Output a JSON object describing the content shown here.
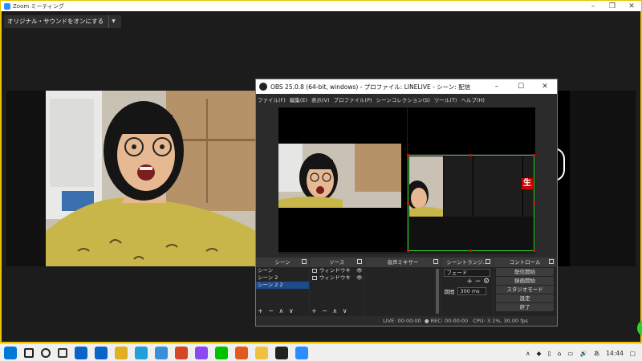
{
  "zoom": {
    "title": "Zoom ミーティング",
    "audio_button": "オリジナル・サウンドをオンにする",
    "window_controls": [
      "–",
      "❐",
      "✕"
    ]
  },
  "obs": {
    "title": "OBS 25.0.8 (64-bit, windows) - プロファイル: LINELIVE - シーン: 配信",
    "window_controls": [
      "–",
      "☐",
      "✕"
    ],
    "menu": [
      "ファイル(F)",
      "編集(E)",
      "表示(V)",
      "プロファイル(P)",
      "シーンコレクション(S)",
      "ツール(T)",
      "ヘルプ(H)"
    ],
    "docks": {
      "scenes_title": "シーン",
      "scenes": [
        "シーン",
        "シーン 2",
        "シーン 2 2"
      ],
      "sources_title": "ソース",
      "sources": [
        "ウィンドウキ",
        "ウィンドウキ"
      ],
      "mixer_title": "音声ミキサー",
      "transitions_title": "シーントランジ…",
      "transition_value": "フェード",
      "duration_label": "期間",
      "duration_value": "300 ms",
      "controls_title": "コントロール",
      "controls": [
        "配信開始",
        "録画開始",
        "スタジオモード",
        "設定",
        "終了"
      ],
      "footer_add_remove": "+ − ∧ ∨"
    },
    "live_char": "生",
    "status": {
      "live": "LIVE: 00:00:00",
      "rec": "REC: 00:00:00",
      "cpu": "CPU: 3.1%, 30.00 fps"
    }
  },
  "taskbar": {
    "clock": "14:44",
    "icons": [
      "windows-start",
      "search",
      "cortana",
      "task-view",
      "mail",
      "calendar",
      "chrome",
      "webex",
      "browser",
      "powerpoint",
      "photos",
      "line",
      "paint",
      "explorer",
      "obs",
      "zoom"
    ],
    "colors": [
      "#0078d7",
      "#222222",
      "#222222",
      "#333333",
      "#0a64c8",
      "#0a64c8",
      "#e0b020",
      "#1fa0d8",
      "#3a8fd8",
      "#d24726",
      "#8a4af0",
      "#00c300",
      "#e05a20",
      "#f0c040",
      "#222222",
      "#2d8cff"
    ]
  }
}
